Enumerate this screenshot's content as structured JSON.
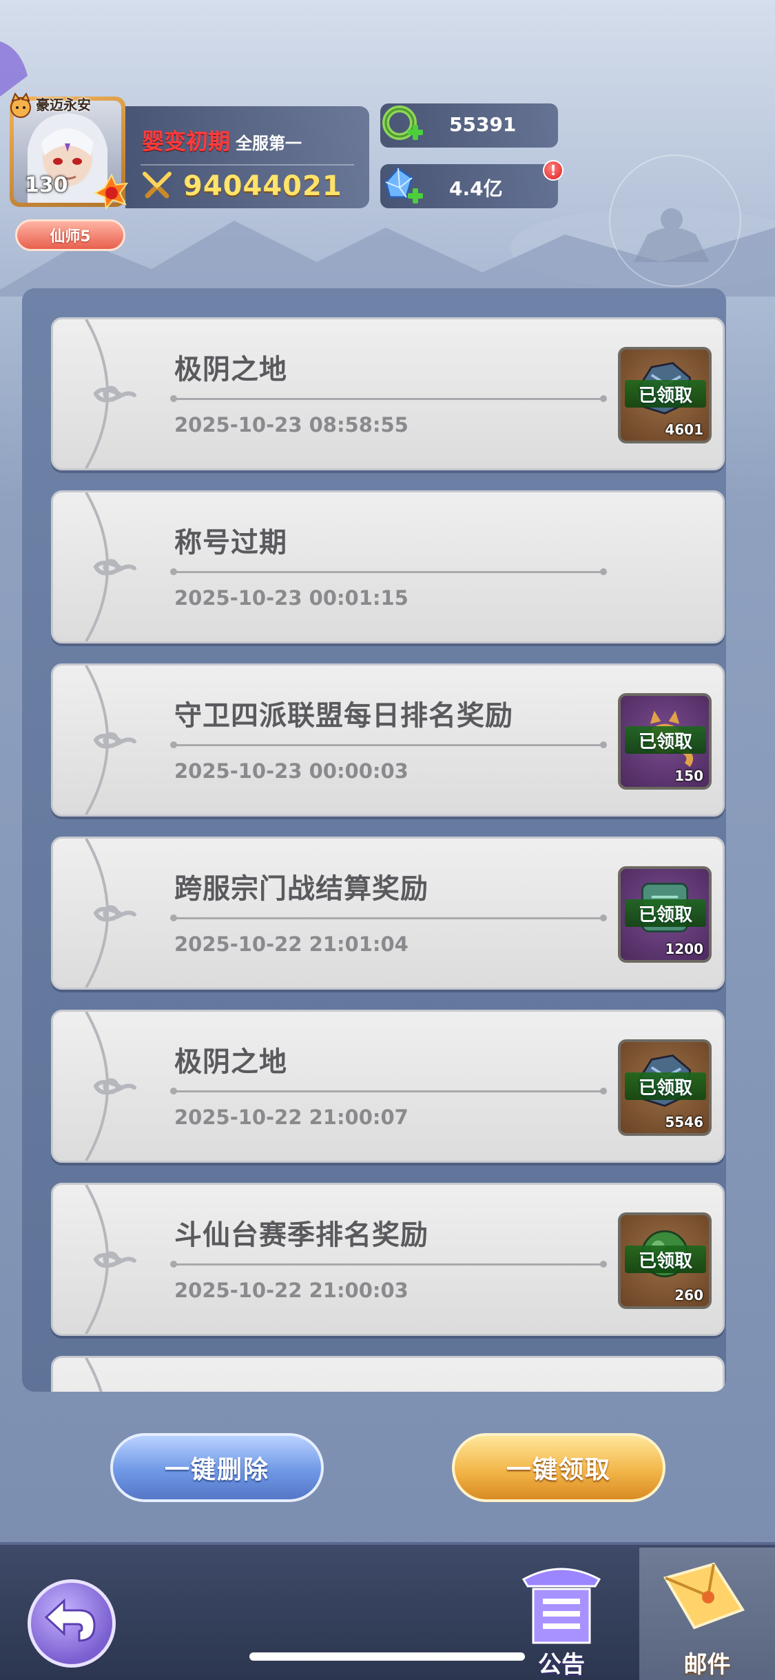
{
  "header": {
    "title_badge": "豪迈永安",
    "level": "130",
    "vip_label": "仙师5",
    "realm": "婴变初期",
    "rank": "全服第一",
    "power": "94044021",
    "currencies": [
      {
        "icon": "jade-ring-icon",
        "value": "55391"
      },
      {
        "icon": "crystal-icon",
        "value": "4.4亿"
      }
    ],
    "alert": "!"
  },
  "mails": [
    {
      "title": "极阴之地",
      "date": "2025-10-23 08:58:55",
      "reward": {
        "status": "已领取",
        "qty": "4601",
        "bg": "brown",
        "icon": "ore-icon"
      }
    },
    {
      "title": "称号过期",
      "date": "2025-10-23 00:01:15",
      "reward": null
    },
    {
      "title": "守卫四派联盟每日排名奖励",
      "date": "2025-10-23 00:00:03",
      "reward": {
        "status": "已领取",
        "qty": "150",
        "bg": "purple",
        "icon": "fox-spirit-icon"
      }
    },
    {
      "title": "跨服宗门战结算奖励",
      "date": "2025-10-22 21:01:04",
      "reward": {
        "status": "已领取",
        "qty": "1200",
        "bg": "purple",
        "icon": "jade-token-icon"
      }
    },
    {
      "title": "极阴之地",
      "date": "2025-10-22 21:00:07",
      "reward": {
        "status": "已领取",
        "qty": "5546",
        "bg": "brown",
        "icon": "ore-icon"
      }
    },
    {
      "title": "斗仙台赛季排名奖励",
      "date": "2025-10-22 21:00:03",
      "reward": {
        "status": "已领取",
        "qty": "260",
        "bg": "brown",
        "icon": "green-orb-icon"
      }
    }
  ],
  "actions": {
    "delete_all": "一键删除",
    "claim_all": "一键领取"
  },
  "nav": {
    "notice": "公告",
    "mail": "邮件"
  }
}
